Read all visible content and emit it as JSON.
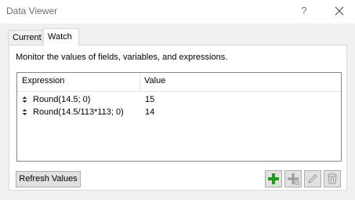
{
  "window": {
    "title": "Data Viewer",
    "help_glyph": "?"
  },
  "tabs": [
    {
      "label": "Current",
      "selected": false
    },
    {
      "label": "Watch",
      "selected": true
    }
  ],
  "panel": {
    "description": "Monitor the values of fields, variables, and expressions."
  },
  "list": {
    "columns": {
      "expression": "Expression",
      "value": "Value"
    },
    "rows": [
      {
        "expression": "Round(14.5; 0)",
        "value": "15"
      },
      {
        "expression": "Round(14.5/113*113; 0)",
        "value": "14"
      }
    ]
  },
  "buttons": {
    "refresh_label": "Refresh Values"
  },
  "toolbar_icons": [
    "add-icon",
    "add-sub-icon",
    "edit-icon",
    "delete-icon"
  ],
  "colors": {
    "add_green": "#1e9e1e",
    "disabled_gray": "#a0a0a0",
    "title_text": "#6e6e6e"
  }
}
